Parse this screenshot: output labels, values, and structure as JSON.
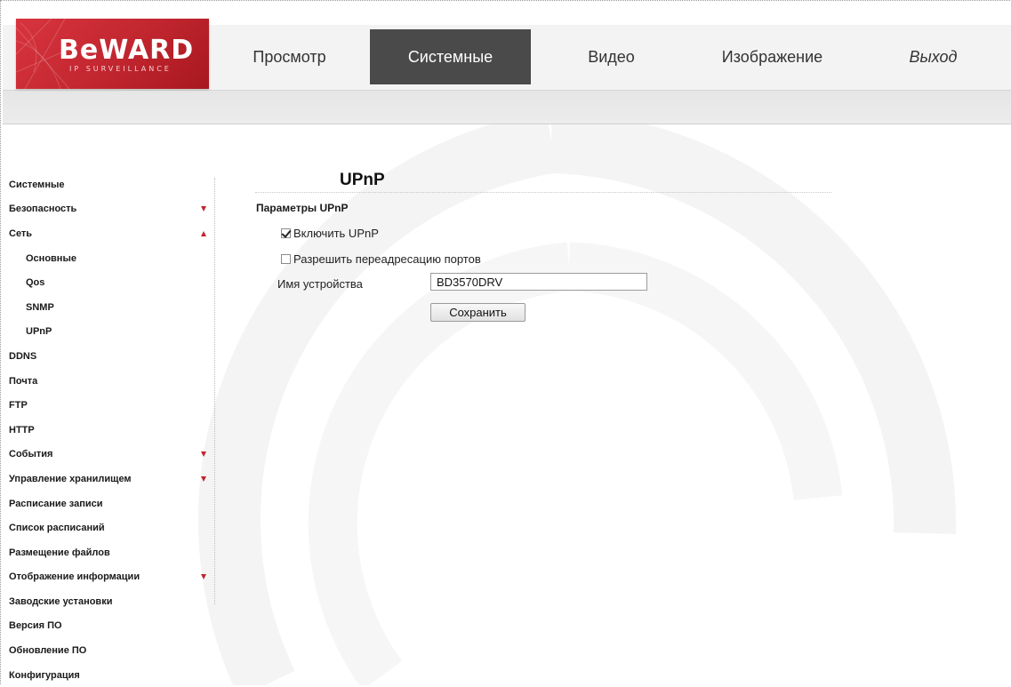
{
  "brand": {
    "name": "BeWARD",
    "tagline": "IP SURVEILLANCE",
    "color": "#c7262f"
  },
  "nav": {
    "tabs": [
      {
        "label": "Просмотр",
        "active": false
      },
      {
        "label": "Системные",
        "active": true
      },
      {
        "label": "Видео",
        "active": false
      },
      {
        "label": "Изображение",
        "active": false
      },
      {
        "label": "Выход",
        "active": false
      }
    ]
  },
  "sidebar": {
    "items": [
      {
        "label": "Системные",
        "arrow": null
      },
      {
        "label": "Безопасность",
        "arrow": "down"
      },
      {
        "label": "Сеть",
        "arrow": "up"
      },
      {
        "label": "Основные",
        "arrow": null,
        "sub": true
      },
      {
        "label": "Qos",
        "arrow": null,
        "sub": true
      },
      {
        "label": "SNMP",
        "arrow": null,
        "sub": true
      },
      {
        "label": "UPnP",
        "arrow": null,
        "sub": true
      },
      {
        "label": "DDNS",
        "arrow": null
      },
      {
        "label": "Почта",
        "arrow": null
      },
      {
        "label": "FTP",
        "arrow": null
      },
      {
        "label": "HTTP",
        "arrow": null
      },
      {
        "label": "События",
        "arrow": "down"
      },
      {
        "label": "Управление хранилищем",
        "arrow": "down"
      },
      {
        "label": "Расписание записи",
        "arrow": null
      },
      {
        "label": "Список расписаний",
        "arrow": null
      },
      {
        "label": "Размещение файлов",
        "arrow": null
      },
      {
        "label": "Отображение информации",
        "arrow": "down"
      },
      {
        "label": "Заводские установки",
        "arrow": null
      },
      {
        "label": "Версия ПО",
        "arrow": null
      },
      {
        "label": "Обновление ПО",
        "arrow": null
      },
      {
        "label": "Конфигурация",
        "arrow": null
      }
    ],
    "arrow_color": "#c0252e"
  },
  "content": {
    "title": "UPnP",
    "section": "Параметры UPnP",
    "enable_upnp": {
      "label": "Включить UPnP",
      "checked": true
    },
    "port_forwarding": {
      "label": "Разрешить переадресацию портов",
      "checked": false
    },
    "device_name": {
      "label": "Имя устройства",
      "value": "BD3570DRV"
    },
    "save_label": "Сохранить"
  },
  "theme": {
    "active_tab_bg": "#4a4a4a",
    "header_bg": "#f3f3f3"
  }
}
